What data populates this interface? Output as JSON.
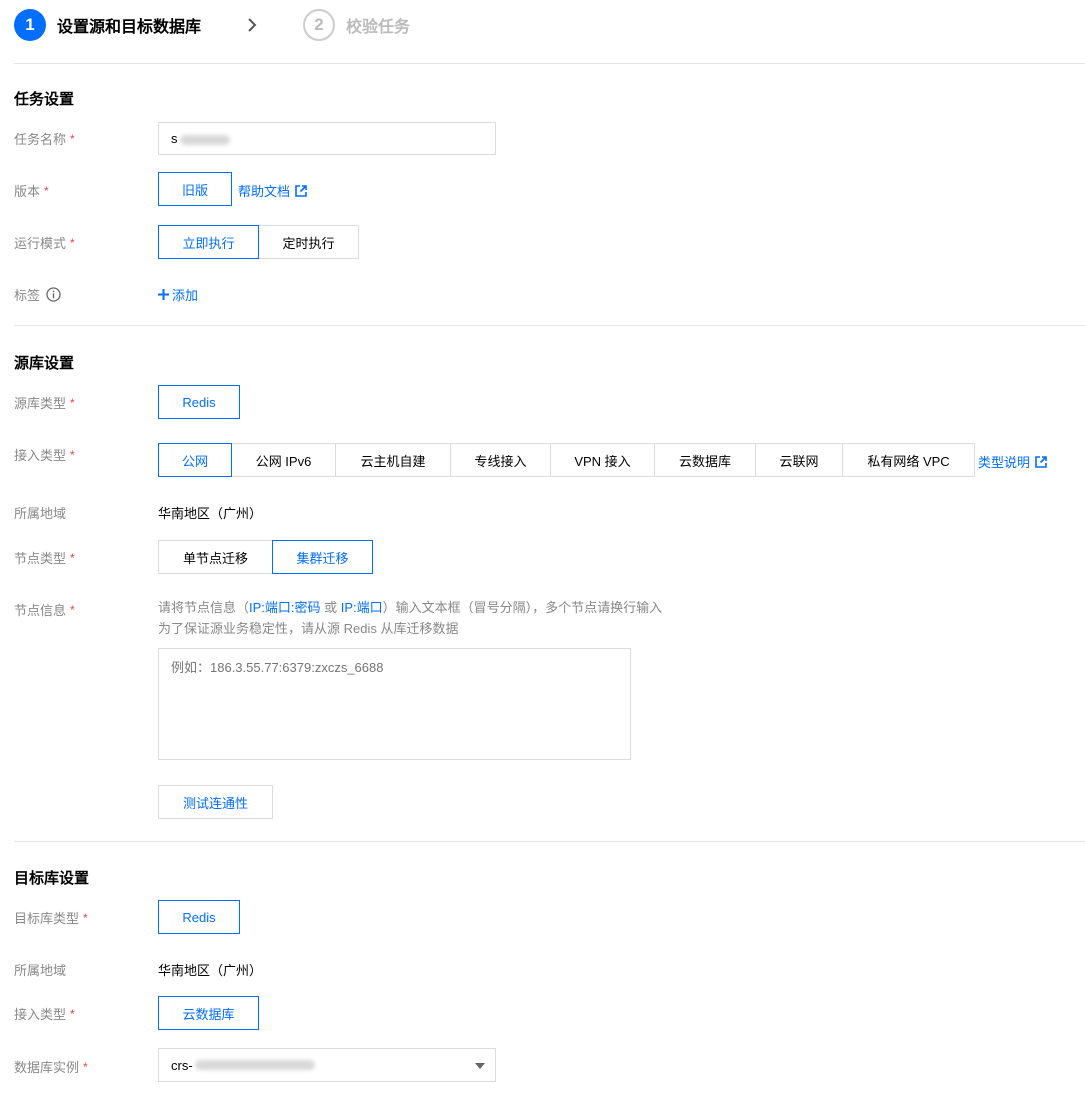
{
  "steps": [
    {
      "num": "1",
      "label": "设置源和目标数据库"
    },
    {
      "num": "2",
      "label": "校验任务"
    }
  ],
  "task": {
    "title": "任务设置",
    "name_label": "任务名称",
    "name_value": "s",
    "version_label": "版本",
    "version_button": "旧版",
    "help_doc": "帮助文档",
    "run_mode_label": "运行模式",
    "run_modes": [
      "立即执行",
      "定时执行"
    ],
    "run_mode_selected": "立即执行",
    "tag_label": "标签",
    "tag_add": "添加"
  },
  "source": {
    "title": "源库设置",
    "type_label": "源库类型",
    "type_value": "Redis",
    "access_label": "接入类型",
    "access_options": [
      "公网",
      "公网 IPv6",
      "云主机自建",
      "专线接入",
      "VPN 接入",
      "云数据库",
      "云联网",
      "私有网络 VPC"
    ],
    "access_selected": "公网",
    "type_doc": "类型说明",
    "region_label": "所属地域",
    "region_value": "华南地区（广州）",
    "node_type_label": "节点类型",
    "node_types": [
      "单节点迁移",
      "集群迁移"
    ],
    "node_type_selected": "集群迁移",
    "node_info_label": "节点信息",
    "hint_pre": "请将节点信息（",
    "hint_fmt1": "IP:端口:密码",
    "hint_or": " 或 ",
    "hint_fmt2": "IP:端口",
    "hint_post": "）输入文本框（冒号分隔），多个节点请换行输入",
    "hint_line2": "为了保证源业务稳定性，请从源 Redis 从库迁移数据",
    "textarea_placeholder": "例如：186.3.55.77:6379:zxczs_6688",
    "test_button": "测试连通性"
  },
  "target": {
    "title": "目标库设置",
    "type_label": "目标库类型",
    "type_value": "Redis",
    "region_label": "所属地域",
    "region_value": "华南地区（广州）",
    "access_label": "接入类型",
    "access_value": "云数据库",
    "instance_label": "数据库实例",
    "instance_value": "crs-"
  },
  "colors": {
    "accent": "#006eff",
    "required": "#e54545",
    "label": "#888888",
    "border": "#dcdcdc"
  }
}
